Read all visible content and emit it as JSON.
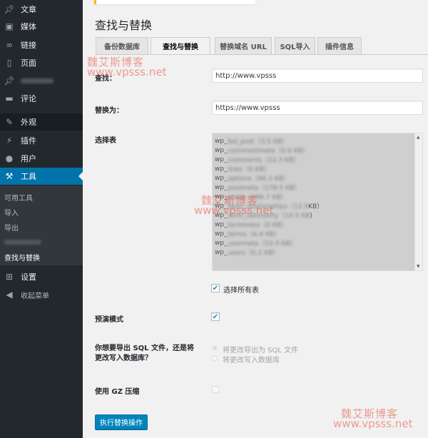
{
  "sidebar": {
    "items": [
      {
        "label": "文章",
        "icon": "pin-icon"
      },
      {
        "label": "媒体",
        "icon": "media-icon"
      },
      {
        "label": "链接",
        "icon": "link-icon"
      },
      {
        "label": "页面",
        "icon": "page-icon"
      },
      {
        "label": "",
        "icon": "pin-icon"
      },
      {
        "label": "评论",
        "icon": "comment-icon"
      },
      {
        "label": "外观",
        "icon": "brush-icon"
      },
      {
        "label": "插件",
        "icon": "plugin-icon"
      },
      {
        "label": "用户",
        "icon": "user-icon"
      },
      {
        "label": "工具",
        "icon": "wrench-icon"
      },
      {
        "label": "设置",
        "icon": "settings-icon"
      },
      {
        "label": "收起菜单",
        "icon": "collapse-icon"
      }
    ],
    "submenu": [
      "可用工具",
      "导入",
      "导出",
      "",
      "查找与替换"
    ]
  },
  "page": {
    "title": "查找与替换"
  },
  "tabs": [
    {
      "label": "备份数据库",
      "active": false
    },
    {
      "label": "查找与替换",
      "active": true
    },
    {
      "label": "替换域名 URL",
      "active": false
    },
    {
      "label": "SQL导入",
      "active": false
    },
    {
      "label": "插件信息",
      "active": false
    }
  ],
  "form": {
    "search_label": "查找：",
    "search_value": "http://www.vpsss",
    "replace_label": "替换为：",
    "replace_value": "https://www.vpsss",
    "tables_label": "选择表",
    "tables": [
      {
        "prefix": "wp_",
        "blurred": "bsl_post（3.5 KB）",
        "tail": ""
      },
      {
        "prefix": "wp_",
        "blurred": "commentmeta（0.0 KB）",
        "tail": ""
      },
      {
        "prefix": "wp_",
        "blurred": "comments（22.3 KB）",
        "tail": ""
      },
      {
        "prefix": "wp_",
        "blurred": "links（0 KB）",
        "tail": ""
      },
      {
        "prefix": "wp_",
        "blurred": "options（46.3 KB）",
        "tail": ""
      },
      {
        "prefix": "wp_",
        "blurred": "postmeta（178.5 KB）",
        "tail": ""
      },
      {
        "prefix": "wp_",
        "blurred": "posts（496.7 KB）",
        "tail": ""
      },
      {
        "prefix": "wp_",
        "blurred": "term_relationships（12.9",
        "tail": "KB）"
      },
      {
        "prefix": "wp_",
        "blurred": "term_taxonomy（10.5 KB",
        "tail": "）"
      },
      {
        "prefix": "wp_",
        "blurred": "termmeta（0 KB）",
        "tail": ""
      },
      {
        "prefix": "wp_",
        "blurred": "terms（4.4 KB）",
        "tail": ""
      },
      {
        "prefix": "wp_",
        "blurred": "usermeta（10.0 KB）",
        "tail": ""
      },
      {
        "prefix": "wp_",
        "blurred": "users（0.2 KB）",
        "tail": ""
      }
    ],
    "select_all_label": "选择所有表",
    "dry_run_label": "预演模式",
    "export_question": "你想要导出 SQL 文件，还是将更改写入数据库？",
    "export_options": [
      "将更改导出为 SQL 文件",
      "将更改写入数据库"
    ],
    "gz_label": "使用 GZ 压缩",
    "submit_label": "执行替换操作"
  },
  "watermarks": {
    "cn": "魏艾斯博客",
    "url": "www.vpsss.net"
  },
  "colors": {
    "sidebar_bg": "#23282d",
    "accent": "#0073aa",
    "button": "#0085ba",
    "watermark": "#e8503c"
  }
}
